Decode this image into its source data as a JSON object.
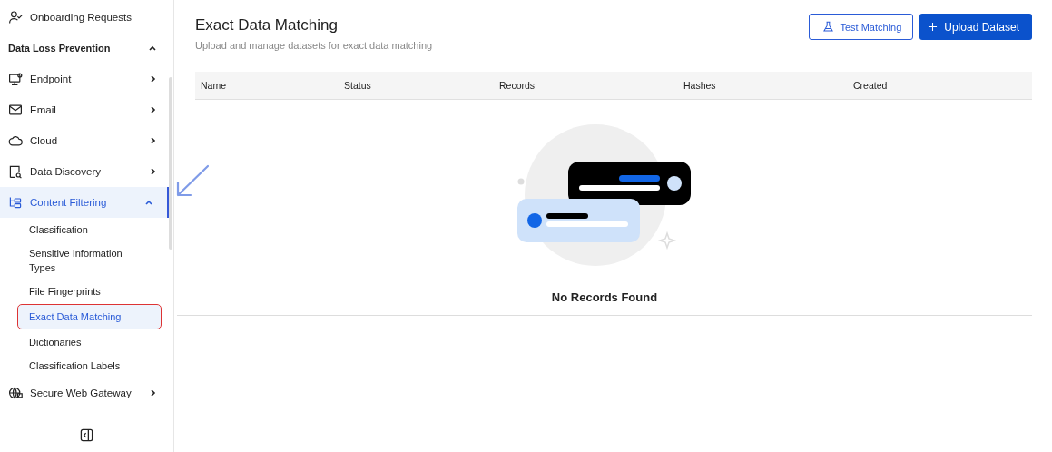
{
  "sidebar": {
    "items": [
      {
        "kind": "link",
        "label": "Onboarding Requests"
      },
      {
        "kind": "section",
        "label": "Data Loss Prevention",
        "expanded": true
      },
      {
        "kind": "group",
        "label": "Endpoint",
        "expanded": false,
        "selected": false
      },
      {
        "kind": "group",
        "label": "Email",
        "expanded": false,
        "selected": false
      },
      {
        "kind": "group",
        "label": "Cloud",
        "expanded": false,
        "selected": false
      },
      {
        "kind": "group",
        "label": "Data Discovery",
        "expanded": false,
        "selected": false
      },
      {
        "kind": "group",
        "label": "Content Filtering",
        "expanded": true,
        "selected": true,
        "children": [
          {
            "label": "Classification",
            "selected": false,
            "annotated": false
          },
          {
            "label": "Sensitive Information Types",
            "selected": false,
            "annotated": false
          },
          {
            "label": "File Fingerprints",
            "selected": false,
            "annotated": false
          },
          {
            "label": "Exact Data Matching",
            "selected": true,
            "annotated": true
          },
          {
            "label": "Dictionaries",
            "selected": false,
            "annotated": false
          },
          {
            "label": "Classification Labels",
            "selected": false,
            "annotated": false
          }
        ]
      },
      {
        "kind": "group",
        "label": "Secure Web Gateway",
        "expanded": false,
        "selected": false
      }
    ]
  },
  "page": {
    "title": "Exact Data Matching",
    "subtitle": "Upload and manage datasets for exact data matching",
    "buttons": [
      {
        "kind": "outline",
        "label": "Test Matching"
      },
      {
        "kind": "primary",
        "label": "Upload Dataset"
      }
    ]
  },
  "table": {
    "columns": [
      "Name",
      "Status",
      "Records",
      "Hashes",
      "Created"
    ],
    "empty_message": "No Records Found"
  }
}
